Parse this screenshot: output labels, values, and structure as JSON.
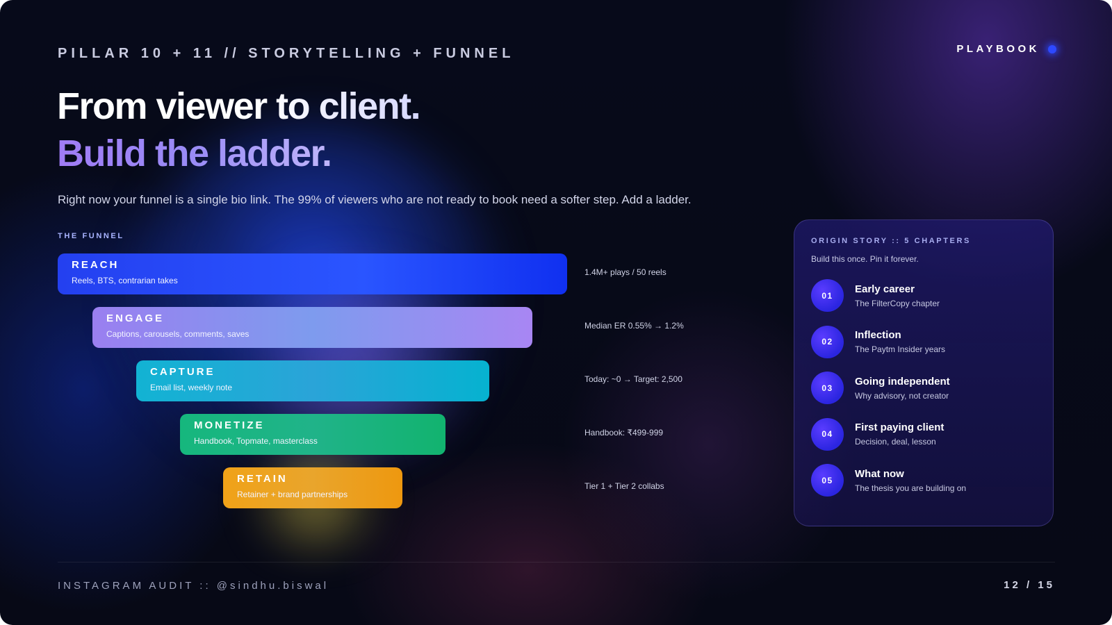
{
  "header": {
    "eyebrow": "PILLAR 10 + 11 // STORYTELLING + FUNNEL",
    "brand": "PLAYBOOK"
  },
  "headline": {
    "line1": "From viewer to client.",
    "line2": "Build the ladder."
  },
  "subtitle": "Right now your funnel is a single bio link. The 99% of viewers who are not ready to book need a softer step. Add a ladder.",
  "funnel": {
    "label": "THE FUNNEL",
    "stages": [
      {
        "title": "REACH",
        "desc": "Reels, BTS, contrarian takes",
        "metric": "1.4M+ plays / 50 reels",
        "color": "#1f3dfb"
      },
      {
        "title": "ENGAGE",
        "desc": "Captions, carousels, comments, saves",
        "metric": "Median ER 0.55% → 1.2%",
        "color": "#8e86ec"
      },
      {
        "title": "CAPTURE",
        "desc": "Email list, weekly note",
        "metric": "Today: ~0 → Target: 2,500",
        "color": "#0ab0cf"
      },
      {
        "title": "MONETIZE",
        "desc": "Handbook, Topmate, masterclass",
        "metric": "Handbook: ₹499-999",
        "color": "#14b47a"
      },
      {
        "title": "RETAIN",
        "desc": "Retainer + brand partnerships",
        "metric": "Tier 1 + Tier 2 collabs",
        "color": "#ef9b12"
      }
    ]
  },
  "origin_story": {
    "label": "ORIGIN STORY  ::  5 CHAPTERS",
    "note": "Build this once. Pin it forever.",
    "chapters": [
      {
        "num": "01",
        "title": "Early career",
        "sub": "The FilterCopy chapter"
      },
      {
        "num": "02",
        "title": "Inflection",
        "sub": "The Paytm Insider years"
      },
      {
        "num": "03",
        "title": "Going independent",
        "sub": "Why advisory, not creator"
      },
      {
        "num": "04",
        "title": "First paying client",
        "sub": "Decision, deal, lesson"
      },
      {
        "num": "05",
        "title": "What now",
        "sub": "The thesis you are building on"
      }
    ]
  },
  "footer": {
    "left": "INSTAGRAM AUDIT  ::  @sindhu.biswal",
    "page": "12 / 15"
  }
}
